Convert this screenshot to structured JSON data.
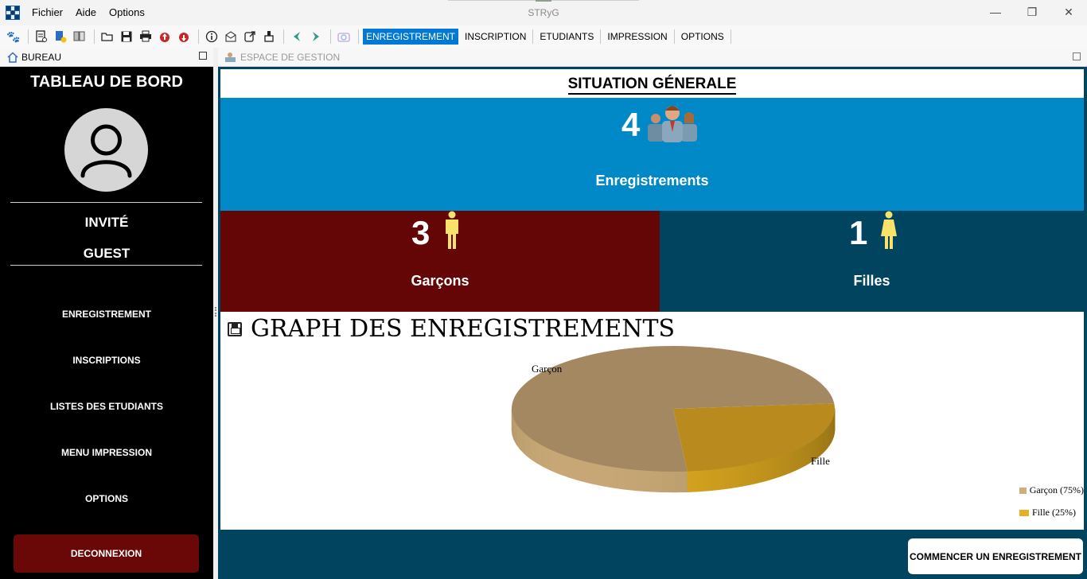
{
  "window": {
    "title": "STRyG"
  },
  "menu": {
    "items": [
      "Fichier",
      "Aide",
      "Options"
    ]
  },
  "toolbar": {
    "tabs": [
      "ENREGISTREMENT",
      "INSCRIPTION",
      "ETUDIANTS",
      "IMPRESSION",
      "OPTIONS"
    ],
    "active_tab": "ENREGISTREMENT"
  },
  "left_panel": {
    "header": "BUREAU",
    "title": "TABLEAU DE BORD",
    "user_name": "INVITÉ",
    "user_role": "GUEST",
    "nav": [
      "ENREGISTREMENT",
      "INSCRIPTIONS",
      "LISTES DES ETUDIANTS",
      "MENU IMPRESSION",
      "OPTIONS"
    ],
    "logout": "DECONNEXION"
  },
  "right_panel": {
    "header": "ESPACE DE GESTION",
    "title": "SITUATION GÉNERALE",
    "total": {
      "count": "4",
      "label": "Enregistrements",
      "color": "#0089c6"
    },
    "boys": {
      "count": "3",
      "label": "Garçons",
      "color": "#650606"
    },
    "girls": {
      "count": "1",
      "label": "Filles",
      "color": "#01445f"
    },
    "graph_title": "GRAPH DES ENREGISTREMENTS",
    "start_button": "COMMENCER UN ENREGISTREMENT"
  },
  "chart_data": {
    "type": "pie",
    "categories": [
      "Garçon",
      "Fille"
    ],
    "values": [
      75,
      25
    ],
    "slice_labels": [
      "Garçon",
      "Fille"
    ],
    "legend_entries": [
      "Garçon (75%)",
      "Fille (25%)"
    ],
    "colors": [
      "#a48862",
      "#b98a1e"
    ],
    "legend_colors": [
      "#cfae7a",
      "#e6b021"
    ],
    "legend": "right"
  }
}
